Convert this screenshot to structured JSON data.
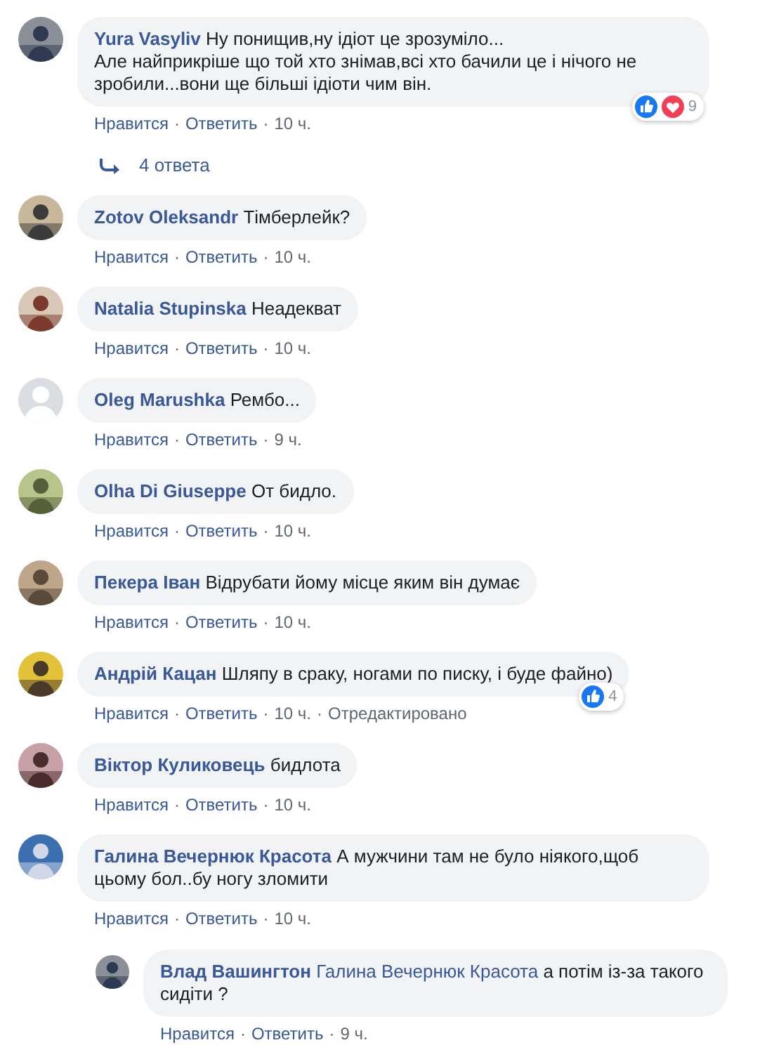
{
  "comments": [
    {
      "avatar": {
        "kind": "picture"
      },
      "author": "Yura Vasyliv",
      "text": "Ну понищив,ну ідіот це зрозуміло...\nАле найприкріше що той хто знімав,всі хто бачили це і нічого не зробили...вони ще більші ідіоти чим він.",
      "reactions": {
        "icons": [
          {
            "kind": "like"
          },
          {
            "kind": "love"
          }
        ],
        "count": "9"
      },
      "actions": [
        {
          "kind": "link",
          "text": "Нравится"
        },
        {
          "kind": "dot",
          "text": "·"
        },
        {
          "kind": "link",
          "text": "Ответить"
        },
        {
          "kind": "dot",
          "text": "·"
        },
        {
          "kind": "time",
          "text": "10 ч."
        }
      ],
      "replies_link": "4 ответа"
    },
    {
      "avatar": {
        "kind": "picture"
      },
      "author": "Zotov Oleksandr",
      "text": "Тімберлейк?",
      "actions": [
        {
          "kind": "link",
          "text": "Нравится"
        },
        {
          "kind": "dot",
          "text": "·"
        },
        {
          "kind": "link",
          "text": "Ответить"
        },
        {
          "kind": "dot",
          "text": "·"
        },
        {
          "kind": "time",
          "text": "10 ч."
        }
      ]
    },
    {
      "avatar": {
        "kind": "picture"
      },
      "author": "Natalia Stupinska",
      "text": "Неадекват",
      "actions": [
        {
          "kind": "link",
          "text": "Нравится"
        },
        {
          "kind": "dot",
          "text": "·"
        },
        {
          "kind": "link",
          "text": "Ответить"
        },
        {
          "kind": "dot",
          "text": "·"
        },
        {
          "kind": "time",
          "text": "10 ч."
        }
      ]
    },
    {
      "avatar": {
        "kind": "default"
      },
      "author": "Oleg Marushka",
      "text": "Рембо...",
      "actions": [
        {
          "kind": "link",
          "text": "Нравится"
        },
        {
          "kind": "dot",
          "text": "·"
        },
        {
          "kind": "link",
          "text": "Ответить"
        },
        {
          "kind": "dot",
          "text": "·"
        },
        {
          "kind": "time",
          "text": "9 ч."
        }
      ]
    },
    {
      "avatar": {
        "kind": "picture"
      },
      "author": "Olha Di Giuseppe",
      "text": "От бидло.",
      "actions": [
        {
          "kind": "link",
          "text": "Нравится"
        },
        {
          "kind": "dot",
          "text": "·"
        },
        {
          "kind": "link",
          "text": "Ответить"
        },
        {
          "kind": "dot",
          "text": "·"
        },
        {
          "kind": "time",
          "text": "10 ч."
        }
      ]
    },
    {
      "avatar": {
        "kind": "picture"
      },
      "author": "Пекера Іван",
      "text": "Відрубати йому місце яким він думає",
      "actions": [
        {
          "kind": "link",
          "text": "Нравится"
        },
        {
          "kind": "dot",
          "text": "·"
        },
        {
          "kind": "link",
          "text": "Ответить"
        },
        {
          "kind": "dot",
          "text": "·"
        },
        {
          "kind": "time",
          "text": "10 ч."
        }
      ]
    },
    {
      "avatar": {
        "kind": "picture"
      },
      "author": "Андрій Кацан",
      "text": "Шляпу в сраку, ногами по писку, і буде файно)",
      "reactions": {
        "icons": [
          {
            "kind": "like"
          }
        ],
        "count": "4"
      },
      "actions": [
        {
          "kind": "link",
          "text": "Нравится"
        },
        {
          "kind": "dot",
          "text": "·"
        },
        {
          "kind": "link",
          "text": "Ответить"
        },
        {
          "kind": "dot",
          "text": "·"
        },
        {
          "kind": "time",
          "text": "10 ч."
        },
        {
          "kind": "dot",
          "text": "·"
        },
        {
          "kind": "time",
          "text": "Отредактировано"
        }
      ]
    },
    {
      "avatar": {
        "kind": "picture"
      },
      "author": "Віктор Куликовець",
      "text": "бидлота",
      "actions": [
        {
          "kind": "link",
          "text": "Нравится"
        },
        {
          "kind": "dot",
          "text": "·"
        },
        {
          "kind": "link",
          "text": "Ответить"
        },
        {
          "kind": "dot",
          "text": "·"
        },
        {
          "kind": "time",
          "text": "10 ч."
        }
      ]
    },
    {
      "avatar": {
        "kind": "picture"
      },
      "author": "Галина Вечернюк Красота",
      "text": "А мужчини там не було ніякого,щоб цьому бол..бу ногу зломити",
      "actions": [
        {
          "kind": "link",
          "text": "Нравится"
        },
        {
          "kind": "dot",
          "text": "·"
        },
        {
          "kind": "link",
          "text": "Ответить"
        },
        {
          "kind": "dot",
          "text": "·"
        },
        {
          "kind": "time",
          "text": "10 ч."
        }
      ],
      "replies": [
        {
          "avatar": {
            "kind": "picture"
          },
          "author": "Влад Вашингтон",
          "mention": "Галина Вечернюк Красота",
          "text": "а потім із-за такого сидіти ?",
          "actions": [
            {
              "kind": "link",
              "text": "Нравится"
            },
            {
              "kind": "dot",
              "text": "·"
            },
            {
              "kind": "link",
              "text": "Ответить"
            },
            {
              "kind": "dot",
              "text": "·"
            },
            {
              "kind": "time",
              "text": "9 ч."
            }
          ]
        }
      ]
    }
  ]
}
